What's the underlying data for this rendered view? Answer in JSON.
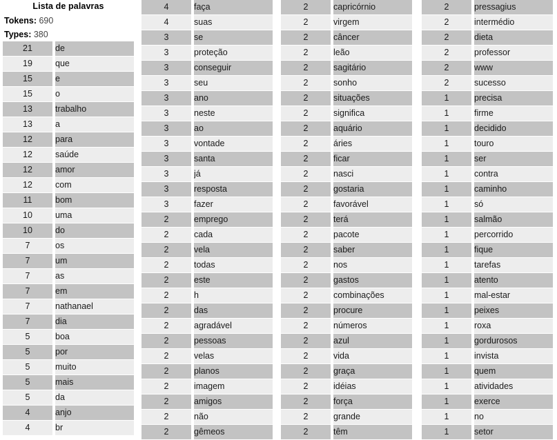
{
  "header": {
    "title": "Lista de palavras",
    "tokens_label": "Tokens:",
    "tokens_value": "690",
    "types_label": "Types:",
    "types_value": "380"
  },
  "colors": {
    "row_dark": "#c3c3c3",
    "row_light": "#ededed",
    "text": "#1a1a1a",
    "background": "#ffffff"
  },
  "columns": [
    {
      "id": "col-1",
      "has_header": true,
      "rows": [
        {
          "count": "21",
          "word": "de"
        },
        {
          "count": "19",
          "word": "que"
        },
        {
          "count": "15",
          "word": "e"
        },
        {
          "count": "15",
          "word": "o"
        },
        {
          "count": "13",
          "word": "trabalho"
        },
        {
          "count": "13",
          "word": "a"
        },
        {
          "count": "12",
          "word": "para"
        },
        {
          "count": "12",
          "word": "saúde"
        },
        {
          "count": "12",
          "word": "amor"
        },
        {
          "count": "12",
          "word": "com"
        },
        {
          "count": "11",
          "word": "bom"
        },
        {
          "count": "10",
          "word": "uma"
        },
        {
          "count": "10",
          "word": "do"
        },
        {
          "count": "7",
          "word": "os"
        },
        {
          "count": "7",
          "word": "um"
        },
        {
          "count": "7",
          "word": "as"
        },
        {
          "count": "7",
          "word": "em"
        },
        {
          "count": "7",
          "word": "nathanael"
        },
        {
          "count": "7",
          "word": "dia"
        },
        {
          "count": "5",
          "word": "boa"
        },
        {
          "count": "5",
          "word": "por"
        },
        {
          "count": "5",
          "word": "muito"
        },
        {
          "count": "5",
          "word": "mais"
        },
        {
          "count": "5",
          "word": "da"
        },
        {
          "count": "4",
          "word": "anjo"
        },
        {
          "count": "4",
          "word": "br"
        }
      ]
    },
    {
      "id": "col-2",
      "has_header": false,
      "rows": [
        {
          "count": "4",
          "word": "faça"
        },
        {
          "count": "4",
          "word": "suas"
        },
        {
          "count": "3",
          "word": "se"
        },
        {
          "count": "3",
          "word": "proteção"
        },
        {
          "count": "3",
          "word": "conseguir"
        },
        {
          "count": "3",
          "word": "seu"
        },
        {
          "count": "3",
          "word": "ano"
        },
        {
          "count": "3",
          "word": "neste"
        },
        {
          "count": "3",
          "word": "ao"
        },
        {
          "count": "3",
          "word": "vontade"
        },
        {
          "count": "3",
          "word": "santa"
        },
        {
          "count": "3",
          "word": "já"
        },
        {
          "count": "3",
          "word": "resposta"
        },
        {
          "count": "3",
          "word": "fazer"
        },
        {
          "count": "2",
          "word": "emprego"
        },
        {
          "count": "2",
          "word": "cada"
        },
        {
          "count": "2",
          "word": "vela"
        },
        {
          "count": "2",
          "word": "todas"
        },
        {
          "count": "2",
          "word": "este"
        },
        {
          "count": "2",
          "word": "h"
        },
        {
          "count": "2",
          "word": "das"
        },
        {
          "count": "2",
          "word": "agradável"
        },
        {
          "count": "2",
          "word": "pessoas"
        },
        {
          "count": "2",
          "word": "velas"
        },
        {
          "count": "2",
          "word": "planos"
        },
        {
          "count": "2",
          "word": "imagem"
        },
        {
          "count": "2",
          "word": "amigos"
        },
        {
          "count": "2",
          "word": "não"
        },
        {
          "count": "2",
          "word": "gêmeos"
        }
      ]
    },
    {
      "id": "col-3",
      "has_header": false,
      "rows": [
        {
          "count": "2",
          "word": "capricórnio"
        },
        {
          "count": "2",
          "word": "virgem"
        },
        {
          "count": "2",
          "word": "câncer"
        },
        {
          "count": "2",
          "word": "leão"
        },
        {
          "count": "2",
          "word": "sagitário"
        },
        {
          "count": "2",
          "word": "sonho"
        },
        {
          "count": "2",
          "word": "situações"
        },
        {
          "count": "2",
          "word": "significa"
        },
        {
          "count": "2",
          "word": "aquário"
        },
        {
          "count": "2",
          "word": "áries"
        },
        {
          "count": "2",
          "word": "ficar"
        },
        {
          "count": "2",
          "word": "nasci"
        },
        {
          "count": "2",
          "word": "gostaria"
        },
        {
          "count": "2",
          "word": "favorável"
        },
        {
          "count": "2",
          "word": "terá"
        },
        {
          "count": "2",
          "word": "pacote"
        },
        {
          "count": "2",
          "word": "saber"
        },
        {
          "count": "2",
          "word": "nos"
        },
        {
          "count": "2",
          "word": "gastos"
        },
        {
          "count": "2",
          "word": "combinações"
        },
        {
          "count": "2",
          "word": "procure"
        },
        {
          "count": "2",
          "word": "números"
        },
        {
          "count": "2",
          "word": "azul"
        },
        {
          "count": "2",
          "word": "vida"
        },
        {
          "count": "2",
          "word": "graça"
        },
        {
          "count": "2",
          "word": "idéias"
        },
        {
          "count": "2",
          "word": "força"
        },
        {
          "count": "2",
          "word": "grande"
        },
        {
          "count": "2",
          "word": "têm"
        }
      ]
    },
    {
      "id": "col-4",
      "has_header": false,
      "rows": [
        {
          "count": "2",
          "word": "pressagius"
        },
        {
          "count": "2",
          "word": "intermédio"
        },
        {
          "count": "2",
          "word": "dieta"
        },
        {
          "count": "2",
          "word": "professor"
        },
        {
          "count": "2",
          "word": "www"
        },
        {
          "count": "2",
          "word": "sucesso"
        },
        {
          "count": "1",
          "word": "precisa"
        },
        {
          "count": "1",
          "word": "firme"
        },
        {
          "count": "1",
          "word": "decidido"
        },
        {
          "count": "1",
          "word": "touro"
        },
        {
          "count": "1",
          "word": "ser"
        },
        {
          "count": "1",
          "word": "contra"
        },
        {
          "count": "1",
          "word": "caminho"
        },
        {
          "count": "1",
          "word": "só"
        },
        {
          "count": "1",
          "word": "salmão"
        },
        {
          "count": "1",
          "word": "percorrido"
        },
        {
          "count": "1",
          "word": "fique"
        },
        {
          "count": "1",
          "word": "tarefas"
        },
        {
          "count": "1",
          "word": "atento"
        },
        {
          "count": "1",
          "word": "mal-estar"
        },
        {
          "count": "1",
          "word": "peixes"
        },
        {
          "count": "1",
          "word": "roxa"
        },
        {
          "count": "1",
          "word": "gordurosos"
        },
        {
          "count": "1",
          "word": "invista"
        },
        {
          "count": "1",
          "word": "quem"
        },
        {
          "count": "1",
          "word": "atividades"
        },
        {
          "count": "1",
          "word": "exerce"
        },
        {
          "count": "1",
          "word": "no"
        },
        {
          "count": "1",
          "word": "setor"
        }
      ]
    }
  ]
}
